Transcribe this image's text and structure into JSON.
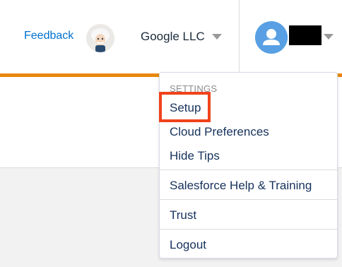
{
  "header": {
    "feedback_label": "Feedback",
    "org_name": "Google LLC",
    "org_avatar_icon": "einstein-avatar-icon",
    "user_avatar_icon": "user-avatar-icon",
    "caret_icon": "caret-down-icon"
  },
  "colors": {
    "accent_orange": "#e8870f",
    "link_blue": "#0070d2",
    "highlight_red": "#f0421b",
    "avatar_blue": "#58a0e3"
  },
  "menu": {
    "section_label": "SETTINGS",
    "items": [
      {
        "label": "Setup"
      },
      {
        "label": "Cloud Preferences"
      },
      {
        "label": "Hide Tips"
      },
      {
        "label": "Salesforce Help & Training"
      },
      {
        "label": "Trust"
      },
      {
        "label": "Logout"
      }
    ]
  }
}
